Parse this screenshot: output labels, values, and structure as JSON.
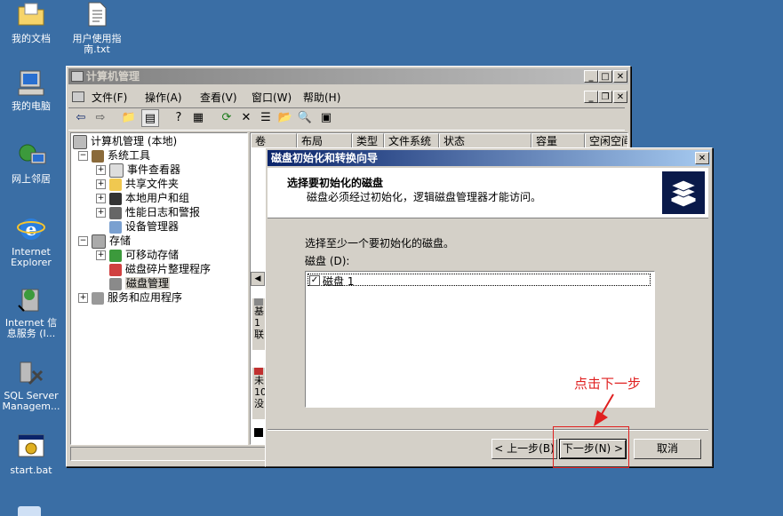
{
  "desktop": {
    "icons": [
      {
        "label": "我的文档",
        "name": "my-documents"
      },
      {
        "label": "用户使用指\n南.txt",
        "name": "user-guide-txt"
      },
      {
        "label": "我的电脑",
        "name": "my-computer"
      },
      {
        "label": "网上邻居",
        "name": "network-places"
      },
      {
        "label": "Internet\nExplorer",
        "name": "internet-explorer"
      },
      {
        "label": "Internet 信\n息服务 (I...",
        "name": "iis"
      },
      {
        "label": "SQL Server\nManagem...",
        "name": "sql-server"
      },
      {
        "label": "start.bat",
        "name": "start-bat"
      }
    ]
  },
  "mmc": {
    "title": "计算机管理",
    "menu": [
      "文件(F)",
      "操作(A)",
      "查看(V)",
      "窗口(W)",
      "帮助(H)"
    ],
    "tree": [
      {
        "label": "计算机管理 (本地)",
        "level": 0,
        "expander": ""
      },
      {
        "label": "系统工具",
        "level": 1,
        "expander": "−"
      },
      {
        "label": "事件查看器",
        "level": 2,
        "expander": "+"
      },
      {
        "label": "共享文件夹",
        "level": 2,
        "expander": "+"
      },
      {
        "label": "本地用户和组",
        "level": 2,
        "expander": "+"
      },
      {
        "label": "性能日志和警报",
        "level": 2,
        "expander": "+"
      },
      {
        "label": "设备管理器",
        "level": 2,
        "expander": ""
      },
      {
        "label": "存储",
        "level": 1,
        "expander": "−"
      },
      {
        "label": "可移动存储",
        "level": 2,
        "expander": "+"
      },
      {
        "label": "磁盘碎片整理程序",
        "level": 2,
        "expander": ""
      },
      {
        "label": "磁盘管理",
        "level": 2,
        "expander": "",
        "selected": true
      },
      {
        "label": "服务和应用程序",
        "level": 1,
        "expander": "+"
      }
    ],
    "columns": [
      "卷",
      "布局",
      "类型",
      "文件系统",
      "状态",
      "容量",
      "空闲空间"
    ],
    "lower_fragments": [
      "基",
      "1",
      "联",
      "未",
      "10",
      "没"
    ]
  },
  "wizard": {
    "title": "磁盘初始化和转换向导",
    "header_title": "选择要初始化的磁盘",
    "header_sub": "磁盘必须经过初始化，逻辑磁盘管理器才能访问。",
    "instruction": "选择至少一个要初始化的磁盘。",
    "disk_label": "磁盘 (D):",
    "disks": [
      {
        "label": "磁盘 1",
        "checked": true
      }
    ],
    "back_label": "< 上一步(B)",
    "next_label": "下一步(N) >",
    "cancel_label": "取消",
    "checkmark": "✓"
  },
  "annotation": {
    "text": "点击下一步",
    "color": "#e02020"
  }
}
